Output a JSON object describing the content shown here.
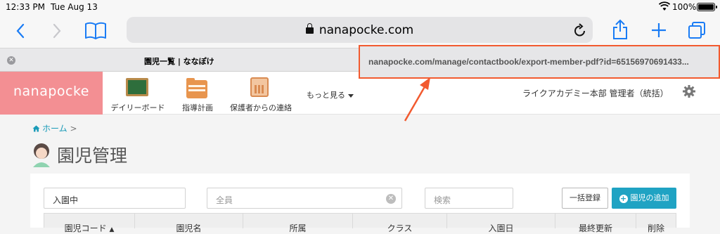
{
  "status_bar": {
    "time": "12:33 PM",
    "date": "Tue Aug 13",
    "battery": "100%",
    "battery_level": 1.0
  },
  "browser": {
    "address": "nanapocke.com",
    "tab_title": "園児一覧 | ななぽけ",
    "url_tooltip": "nanapocke.com/manage/contactbook/export-member-pdf?id=65156970691433..."
  },
  "app": {
    "logo": "nanapocke",
    "nav": [
      {
        "label": "デイリーボード",
        "icon": "chalkboard-icon"
      },
      {
        "label": "指導計画",
        "icon": "folder-icon"
      },
      {
        "label": "保護者からの連絡",
        "icon": "phone-icon"
      }
    ],
    "more": "もっと見る",
    "user": "ライクアカデミー本部 管理者（統括）"
  },
  "content": {
    "breadcrumb_home": "ホーム",
    "breadcrumb_sep": ">",
    "page_title": "園児管理",
    "filter_status": "入園中",
    "filter_group": "全員",
    "search_placeholder": "検索",
    "bulk_button": "一括登録",
    "add_button": "園児の追加",
    "table_headers": [
      "園児コード",
      "園児名",
      "所属",
      "クラス",
      "入園日",
      "最終更新",
      "削除"
    ]
  },
  "colors": {
    "accent": "#1fa3c3",
    "logo_bg": "#f38f93",
    "annotation": "#f25a2f",
    "ios_blue": "#1a7cf5"
  }
}
